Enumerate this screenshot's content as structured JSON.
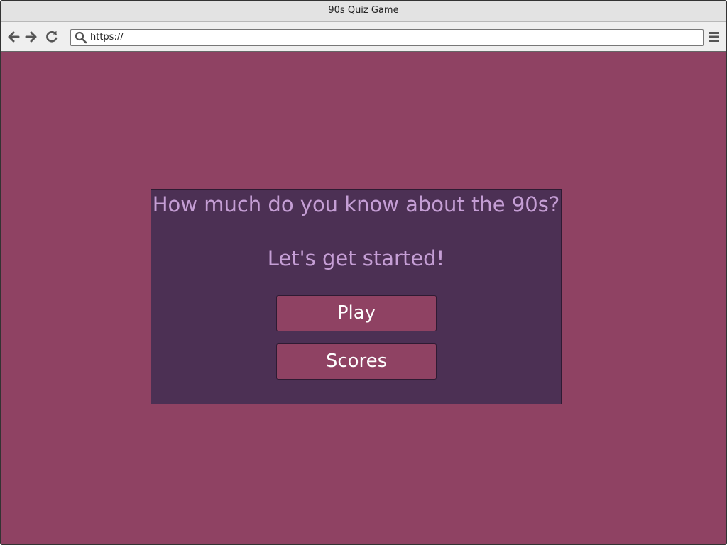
{
  "window": {
    "title": "90s Quiz Game"
  },
  "toolbar": {
    "back_icon": "arrow-left-icon",
    "forward_icon": "arrow-right-icon",
    "reload_icon": "reload-icon",
    "menu_icon": "hamburger-menu-icon",
    "address": {
      "icon": "search-icon",
      "value": "https://"
    }
  },
  "page": {
    "background_color": "#8f4263",
    "card_color": "#4c3054",
    "text_color": "#c59ed5",
    "headline": "How much do you know about the 90s?",
    "subline": "Let's get started!",
    "buttons": {
      "play_label": "Play",
      "scores_label": "Scores"
    }
  }
}
